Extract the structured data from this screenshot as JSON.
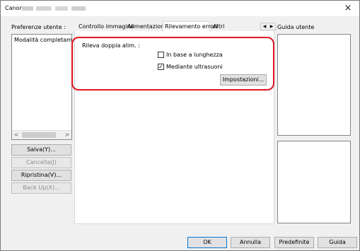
{
  "window": {
    "title": "Canon",
    "close_glyph": "×"
  },
  "left_panel": {
    "label": "Preferenze utente :",
    "list_items": [
      "Modalità completamento"
    ],
    "buttons": {
      "save": "Salva(Y)...",
      "delete": "Cancella(J)",
      "restore": "Ripristina(V)...",
      "backup": "Back Up(X)..."
    }
  },
  "tabs": {
    "items": [
      "Controllo immagine",
      "Alimentazione",
      "Rilevamento errori",
      "Altri"
    ],
    "active": "Rilevamento errori"
  },
  "double_feed": {
    "title": "Rileva doppia alim. :",
    "by_length": {
      "label": "In base a lunghezza",
      "checked": false
    },
    "ultrasonic": {
      "label": "Mediante ultrasuoni",
      "checked": true
    },
    "settings_button": "Impostazioni..."
  },
  "help": {
    "label": "Guida utente"
  },
  "footer": {
    "ok": "OK",
    "cancel": "Annulla",
    "defaults": "Predefinite",
    "help": "Guida"
  },
  "colors": {
    "highlight": "#e0141f",
    "default_button_border": "#0078d7"
  }
}
